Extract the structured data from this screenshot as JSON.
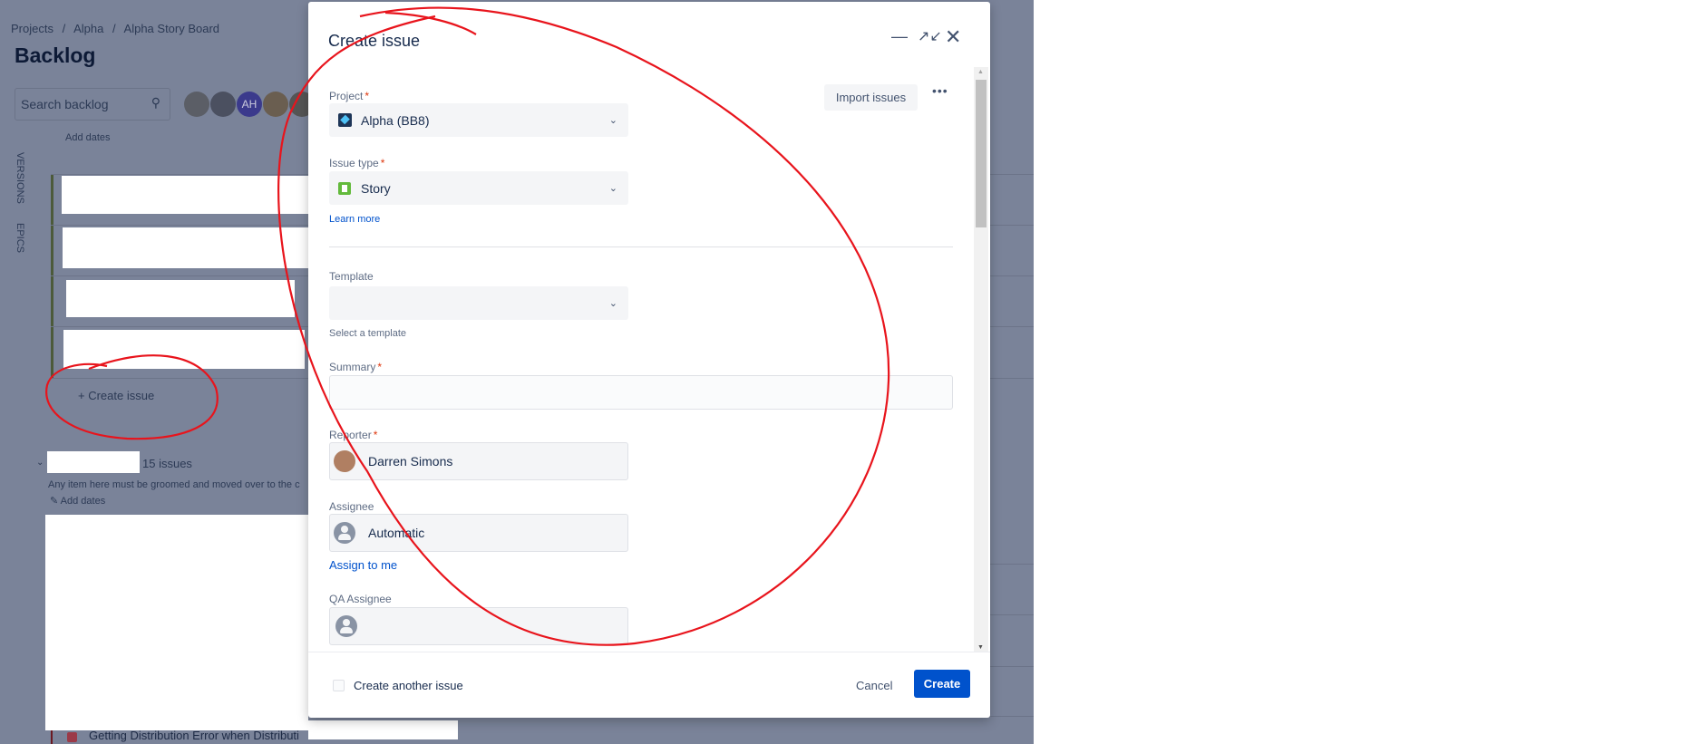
{
  "background": {
    "breadcrumb": [
      "Projects",
      "Alpha",
      "Alpha Story Board"
    ],
    "breadcrumb_sep": "/",
    "page_title": "Backlog",
    "search_placeholder": "Search backlog",
    "avatar_initials": "AH",
    "side_tabs": [
      "VERSIONS",
      "EPICS"
    ],
    "add_dates_top": "Add dates",
    "create_issue": "+ Create issue",
    "backlog_count": "15 issues",
    "backlog_description": "Any item here must be groomed and moved over to the c",
    "add_dates": "Add dates",
    "bottom_issue": "Getting Distribution Error when Distributi"
  },
  "modal": {
    "title": "Create issue",
    "import_button": "Import issues",
    "more": "•••",
    "project": {
      "label": "Project",
      "value": "Alpha (BB8)"
    },
    "issue_type": {
      "label": "Issue type",
      "value": "Story",
      "learn_more": "Learn more"
    },
    "template": {
      "label": "Template",
      "value": "",
      "helper": "Select a template"
    },
    "summary": {
      "label": "Summary",
      "value": ""
    },
    "reporter": {
      "label": "Reporter",
      "value": "Darren Simons"
    },
    "assignee": {
      "label": "Assignee",
      "value": "Automatic",
      "assign_to_me": "Assign to me"
    },
    "qa_assignee": {
      "label": "QA Assignee",
      "value": ""
    },
    "required_mark": "*",
    "footer": {
      "create_another": "Create another issue",
      "create_another_checked": false,
      "cancel": "Cancel",
      "create": "Create"
    }
  },
  "colors": {
    "primary": "#0052cc",
    "overlay": "#7a8399",
    "annotation": "#e8141c"
  }
}
